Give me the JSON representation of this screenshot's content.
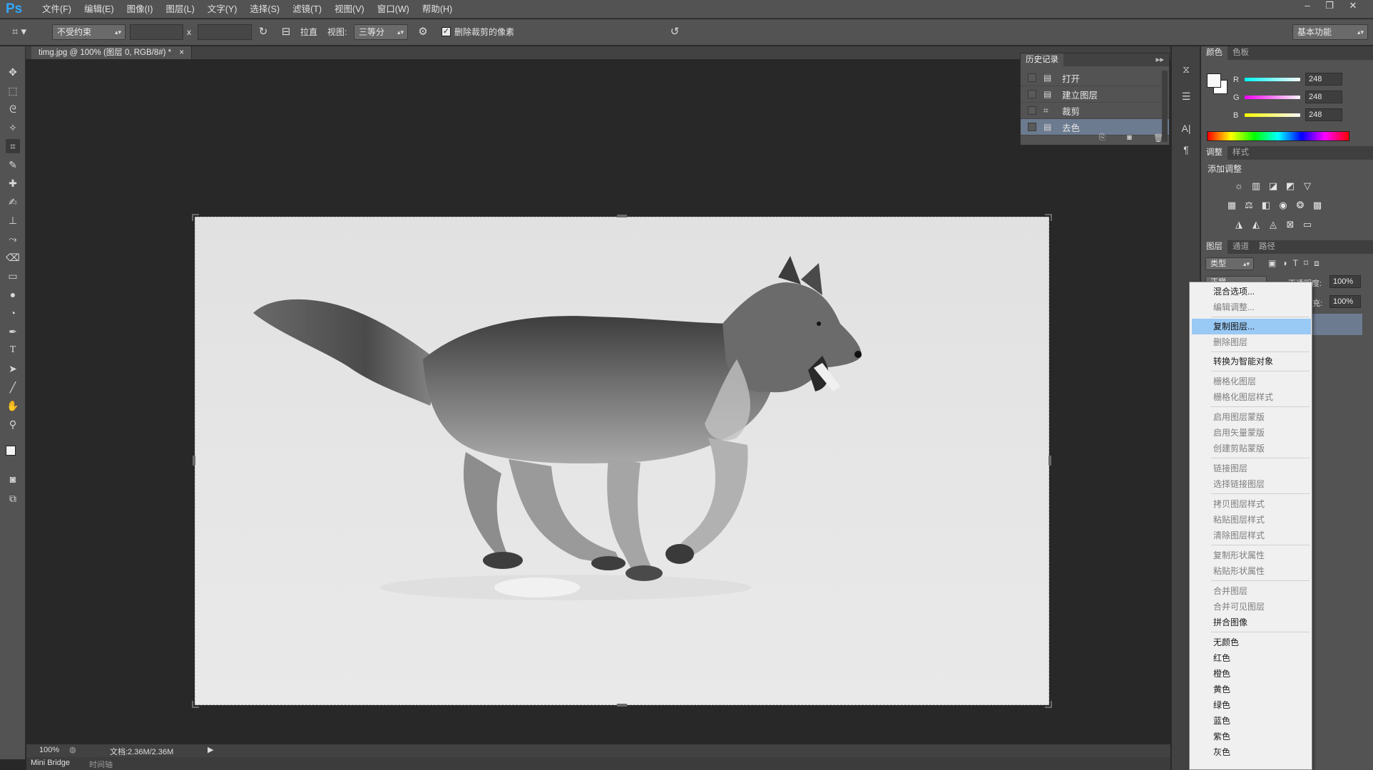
{
  "app": {
    "logo": "Ps",
    "menu": [
      "文件(F)",
      "编辑(E)",
      "图像(I)",
      "图层(L)",
      "文字(Y)",
      "选择(S)",
      "滤镜(T)",
      "视图(V)",
      "窗口(W)",
      "帮助(H)"
    ],
    "window_controls": {
      "minimize": "–",
      "restore": "❐",
      "close": "✕"
    }
  },
  "options": {
    "ratio_select": "不受约束",
    "x_separator": "x",
    "straighten_label": "拉直",
    "view_label": "视图:",
    "view_select": "三等分",
    "delete_cropped_label": "删除裁剪的像素",
    "delete_cropped_checked": true,
    "workspace_select": "基本功能"
  },
  "document": {
    "tab_title": "timg.jpg @ 100% (图层 0, RGB/8#) *",
    "tab_close": "×",
    "zoom": "100%",
    "doc_info": "文档:2.36M/2.36M"
  },
  "bottom_tabs": [
    "Mini Bridge",
    "时间轴"
  ],
  "history": {
    "tab": "历史记录",
    "rows": [
      {
        "label": "打开",
        "icon": "document-icon"
      },
      {
        "label": "建立图层",
        "icon": "document-icon"
      },
      {
        "label": "裁剪",
        "icon": "crop-icon"
      },
      {
        "label": "去色",
        "icon": "document-icon"
      }
    ],
    "selected": 3
  },
  "color_panel": {
    "tabs": [
      "颜色",
      "色板"
    ],
    "r_label": "R",
    "g_label": "G",
    "b_label": "B",
    "r": "248",
    "g": "248",
    "b": "248"
  },
  "adjustments": {
    "tabs": [
      "调整",
      "样式"
    ],
    "heading": "添加调整"
  },
  "layers": {
    "tabs": [
      "图层",
      "通道",
      "路径"
    ],
    "filter_select": "类型",
    "mode_select": "正常",
    "opacity_label": "不透明度:",
    "opacity": "100%",
    "fill_label": "充:",
    "fill": "100%"
  },
  "context_menu": {
    "items": [
      {
        "label": "混合选项...",
        "disabled": false
      },
      {
        "label": "编辑调整...",
        "disabled": true
      },
      {
        "label": "复制图层...",
        "disabled": false,
        "highlight": true
      },
      {
        "label": "删除图层",
        "disabled": true
      },
      {
        "label": "转换为智能对象",
        "disabled": false
      },
      {
        "label": "栅格化图层",
        "disabled": true
      },
      {
        "label": "栅格化图层样式",
        "disabled": true
      },
      {
        "label": "启用图层蒙版",
        "disabled": true
      },
      {
        "label": "启用矢量蒙版",
        "disabled": true
      },
      {
        "label": "创建剪贴蒙版",
        "disabled": true
      },
      {
        "label": "链接图层",
        "disabled": true
      },
      {
        "label": "选择链接图层",
        "disabled": true
      },
      {
        "label": "拷贝图层样式",
        "disabled": true
      },
      {
        "label": "粘贴图层样式",
        "disabled": true
      },
      {
        "label": "清除图层样式",
        "disabled": true
      },
      {
        "label": "复制形状属性",
        "disabled": true
      },
      {
        "label": "粘贴形状属性",
        "disabled": true
      },
      {
        "label": "合并图层",
        "disabled": true
      },
      {
        "label": "合并可见图层",
        "disabled": true
      },
      {
        "label": "拼合图像",
        "disabled": false
      },
      {
        "label": "无颜色",
        "disabled": false
      },
      {
        "label": "红色",
        "disabled": false
      },
      {
        "label": "橙色",
        "disabled": false
      },
      {
        "label": "黄色",
        "disabled": false
      },
      {
        "label": "绿色",
        "disabled": false
      },
      {
        "label": "蓝色",
        "disabled": false
      },
      {
        "label": "紫色",
        "disabled": false
      },
      {
        "label": "灰色",
        "disabled": false
      }
    ]
  }
}
